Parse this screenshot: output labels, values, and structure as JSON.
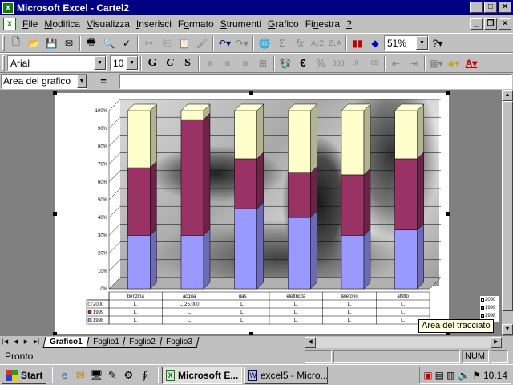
{
  "window": {
    "title": "Microsoft Excel - Cartel2"
  },
  "menu": [
    {
      "label": "File",
      "key": "F"
    },
    {
      "label": "Modifica",
      "key": "M"
    },
    {
      "label": "Visualizza",
      "key": "V"
    },
    {
      "label": "Inserisci",
      "key": "I"
    },
    {
      "label": "Formato",
      "key": "o"
    },
    {
      "label": "Strumenti",
      "key": "S"
    },
    {
      "label": "Grafico",
      "key": "G"
    },
    {
      "label": "Finestra",
      "key": "n"
    },
    {
      "label": "?",
      "key": "?"
    }
  ],
  "standard_toolbar": {
    "zoom": "51%"
  },
  "format_toolbar": {
    "font": "Arial",
    "size": "10",
    "bold": "G",
    "italic": "C",
    "underline": "S",
    "currency": "€",
    "percent": "%"
  },
  "formula_bar": {
    "name_box": "Area del grafico",
    "equals": "="
  },
  "chart_data": {
    "type": "bar",
    "stacked": "percent",
    "categories": [
      "benzina",
      "acqua",
      "gas",
      "elettricità",
      "telefono",
      "affitto"
    ],
    "series": [
      {
        "name": "1998",
        "values": [
          30,
          30,
          45,
          40,
          30,
          33
        ],
        "color": "#9999ff"
      },
      {
        "name": "1999",
        "values": [
          38,
          65,
          28,
          25,
          34,
          40
        ],
        "color": "#993366"
      },
      {
        "name": "2000",
        "values": [
          32,
          5,
          27,
          35,
          36,
          27
        ],
        "color": "#ffffcc"
      }
    ],
    "y_ticks": [
      "0%",
      "10%",
      "20%",
      "30%",
      "40%",
      "50%",
      "60%",
      "70%",
      "80%",
      "90%",
      "100%"
    ],
    "ylim": [
      0,
      100
    ],
    "legend": "right",
    "data_table": {
      "rows": [
        {
          "name": "2000",
          "cells": [
            "L.",
            "L. 25.000",
            "L.",
            "L.",
            "L.",
            "L."
          ]
        },
        {
          "name": "1999",
          "cells": [
            "L.",
            "L.",
            "L.",
            "L.",
            "L.",
            "L."
          ]
        },
        {
          "name": "1998",
          "cells": [
            "L.",
            "L.",
            "L.",
            "L.",
            "L.",
            "L."
          ]
        }
      ]
    }
  },
  "tooltip": "Area del tracciato",
  "sheet_tabs": [
    "Grafico1",
    "Foglio1",
    "Foglio2",
    "Foglio3"
  ],
  "status": {
    "text": "Pronto",
    "num": "NUM"
  },
  "taskbar": {
    "start": "Start",
    "tasks": [
      "Microsoft E...",
      "excel5 - Micro..."
    ],
    "clock": "10.14"
  }
}
